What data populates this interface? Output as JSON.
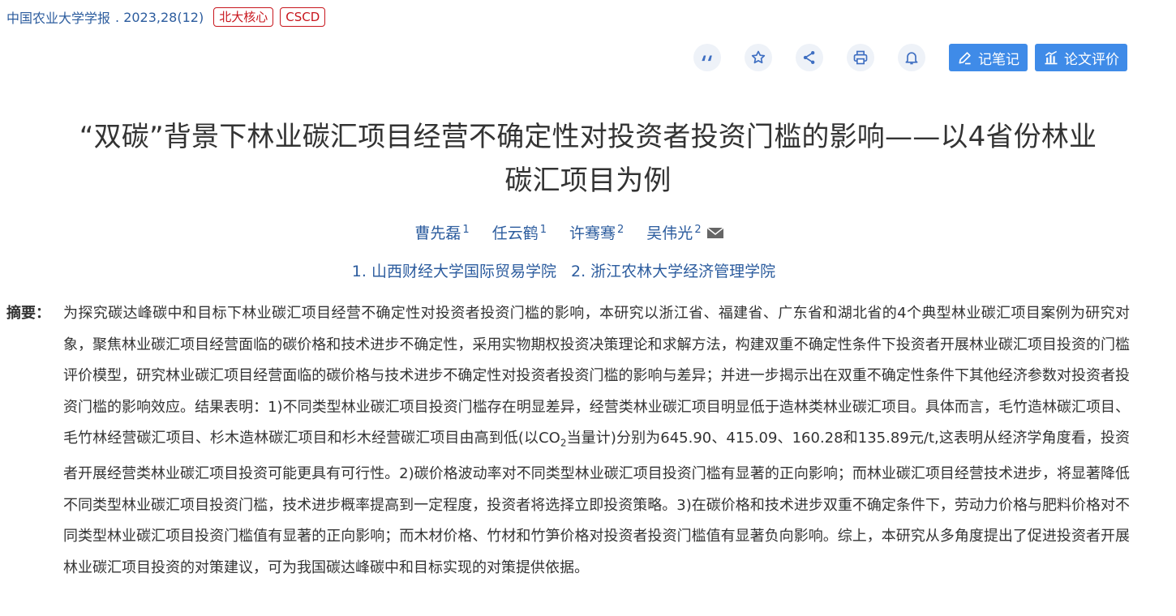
{
  "journal": {
    "name": "中国农业大学学报",
    "issue": " . 2023,28(12)",
    "badges": [
      "北大核心",
      "CSCD"
    ]
  },
  "toolbar": {
    "icons": [
      "quote-icon",
      "star-icon",
      "share-icon",
      "print-icon",
      "bell-icon"
    ],
    "note_label": "记笔记",
    "review_label": "论文评价"
  },
  "article": {
    "title_line1": "“双碳”背景下林业碳汇项目经营不确定性对投资者投资门槛的影响——以4省份林业",
    "title_line2": "碳汇项目为例",
    "authors": [
      {
        "name": "曹先磊",
        "sup": "1"
      },
      {
        "name": "任云鹤",
        "sup": "1"
      },
      {
        "name": "许骞骞",
        "sup": "2"
      },
      {
        "name": "吴伟光",
        "sup": "2"
      }
    ],
    "affiliations": [
      "1. 山西财经大学国际贸易学院",
      "2. 浙江农林大学经济管理学院"
    ]
  },
  "abstract": {
    "label": "摘要：",
    "text_before_sub": "为探究碳达峰碳中和目标下林业碳汇项目经营不确定性对投资者投资门槛的影响，本研究以浙江省、福建省、广东省和湖北省的4个典型林业碳汇项目案例为研究对象，聚焦林业碳汇项目经营面临的碳价格和技术进步不确定性，采用实物期权投资决策理论和求解方法，构建双重不确定性条件下投资者开展林业碳汇项目投资的门槛评价模型，研究林业碳汇项目经营面临的碳价格与技术进步不确定性对投资者投资门槛的影响与差异；并进一步揭示出在双重不确定性条件下其他经济参数对投资者投资门槛的影响效应。结果表明：1)不同类型林业碳汇项目投资门槛存在明显差异，经营类林业碳汇项目明显低于造林类林业碳汇项目。具体而言，毛竹造林碳汇项目、毛竹林经营碳汇项目、杉木造林碳汇项目和杉木经营碳汇项目由高到低(以CO",
    "sub": "2",
    "text_after_sub": "当量计)分别为645.90、415.09、160.28和135.89元/t,这表明从经济学角度看，投资者开展经营类林业碳汇项目投资可能更具有可行性。2)碳价格波动率对不同类型林业碳汇项目投资门槛有显著的正向影响；而林业碳汇项目经营技术进步，将显著降低不同类型林业碳汇项目投资门槛，技术进步概率提高到一定程度，投资者将选择立即投资策略。3)在碳价格和技术进步双重不确定条件下，劳动力价格与肥料价格对不同类型林业碳汇项目投资门槛值有显著的正向影响；而木材价格、竹材和竹笋价格对投资者投资门槛值有显著负向影响。综上，本研究从多角度提出了促进投资者开展林业碳汇项目投资的对策建议，可为我国碳达峰碳中和目标实现的对策提供依据。"
  }
}
